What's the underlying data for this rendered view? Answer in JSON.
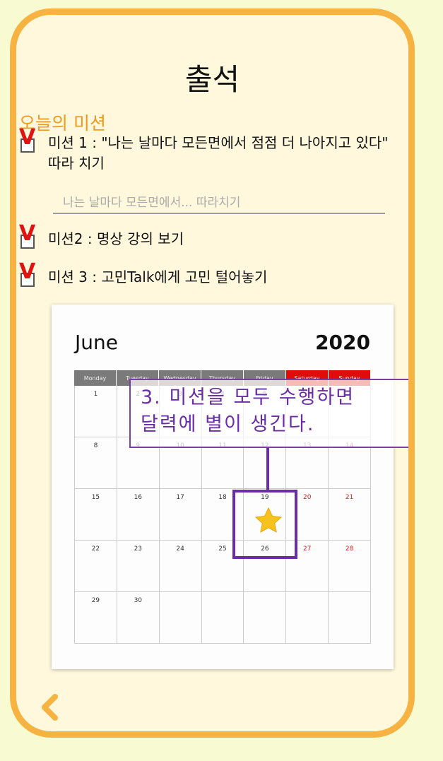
{
  "header": {
    "title": "출석"
  },
  "missions": {
    "section_title": "오늘의 미션",
    "check_mark": "V",
    "items": [
      {
        "label_line1": "미션 1 : \"나는 날마다 모든면에서 점점 더 나아지고 있다\"",
        "label_line2": "따라 치기",
        "checked": true
      },
      {
        "label": "미션2 : 명상 강의 보기",
        "checked": true
      },
      {
        "label": "미션 3 : 고민Talk에게 고민 털어놓기",
        "checked": true
      }
    ],
    "input_placeholder": "나는 날마다 모든면에서... 따라치기"
  },
  "calendar": {
    "month": "June",
    "year": "2020",
    "weekdays": [
      "Monday",
      "Tuesday",
      "Wednesday",
      "Thursday",
      "Friday",
      "Saturday",
      "Sunday"
    ],
    "weeks": [
      [
        "1",
        "2",
        "3",
        "4",
        "5",
        "6",
        "7"
      ],
      [
        "8",
        "9",
        "10",
        "11",
        "12",
        "13",
        "14"
      ],
      [
        "15",
        "16",
        "17",
        "18",
        "19",
        "20",
        "21"
      ],
      [
        "22",
        "23",
        "24",
        "25",
        "26",
        "27",
        "28"
      ],
      [
        "29",
        "30",
        "",
        "",
        "",
        "",
        ""
      ]
    ],
    "starred_day": "19"
  },
  "annotation": {
    "line1": "3. 미션을 모두 수행하면",
    "line2": "달력에 별이 생긴다."
  },
  "colors": {
    "frame": "#f7b341",
    "accent": "#f09a1e",
    "check": "#e01212",
    "annotation": "#6a2da8",
    "weekend_header": "#e00b0b",
    "star": "#f8c21c"
  },
  "icons": {
    "back": "chevron-left-icon",
    "star": "star-icon"
  }
}
